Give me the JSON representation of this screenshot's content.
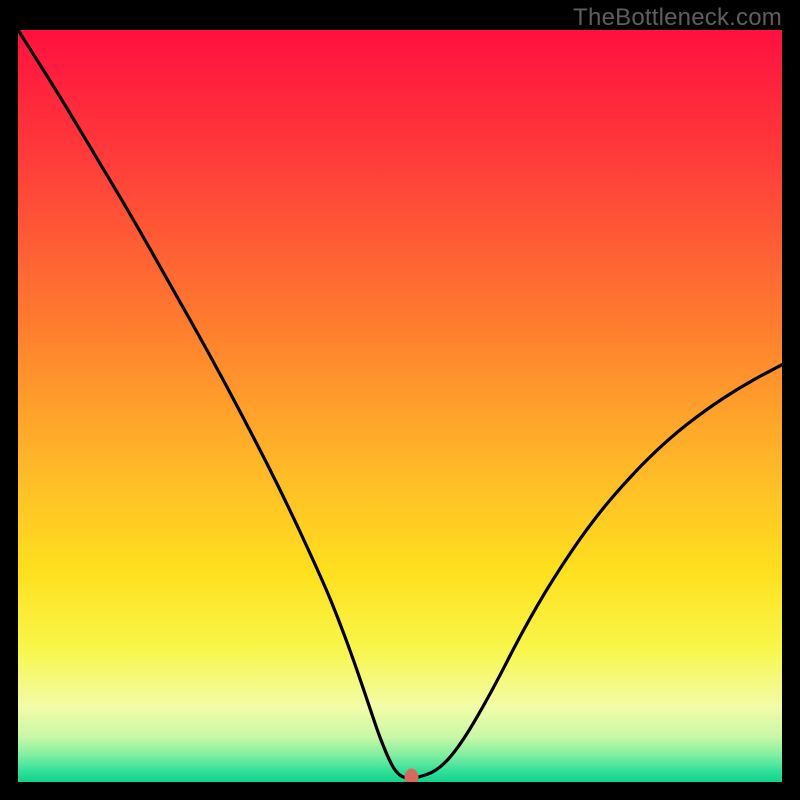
{
  "watermark": "TheBottleneck.com",
  "chart_data": {
    "type": "line",
    "title": "",
    "xlabel": "",
    "ylabel": "",
    "xlim": [
      0,
      100
    ],
    "ylim": [
      0,
      100
    ],
    "background_gradient": {
      "stops": [
        {
          "offset": 0.0,
          "color": "#ff103f"
        },
        {
          "offset": 0.18,
          "color": "#ff3e3a"
        },
        {
          "offset": 0.4,
          "color": "#ff7f2e"
        },
        {
          "offset": 0.58,
          "color": "#ffb828"
        },
        {
          "offset": 0.72,
          "color": "#ffe01e"
        },
        {
          "offset": 0.82,
          "color": "#f8f648"
        },
        {
          "offset": 0.9,
          "color": "#f3fca8"
        },
        {
          "offset": 0.94,
          "color": "#c9f8a6"
        },
        {
          "offset": 0.965,
          "color": "#7deea0"
        },
        {
          "offset": 0.985,
          "color": "#35e09a"
        },
        {
          "offset": 1.0,
          "color": "#0fd28d"
        }
      ]
    },
    "series": [
      {
        "name": "bottleneck-curve",
        "x": [
          0,
          5,
          10,
          15,
          20,
          25,
          30,
          35,
          40,
          42,
          44,
          46,
          47.5,
          49,
          50,
          51,
          52,
          55,
          58,
          62,
          66,
          70,
          75,
          80,
          85,
          90,
          95,
          100
        ],
        "y": [
          100,
          92,
          83.5,
          75,
          66,
          57,
          47.5,
          37.5,
          26.5,
          21.5,
          16,
          10,
          5.5,
          2.0,
          0.8,
          0.5,
          0.5,
          1.5,
          5,
          12,
          20,
          27,
          34.5,
          40.5,
          45.5,
          49.5,
          52.8,
          55.5
        ]
      }
    ],
    "marker": {
      "x": 51.5,
      "y": 0.6,
      "color": "#d66a5f"
    }
  }
}
